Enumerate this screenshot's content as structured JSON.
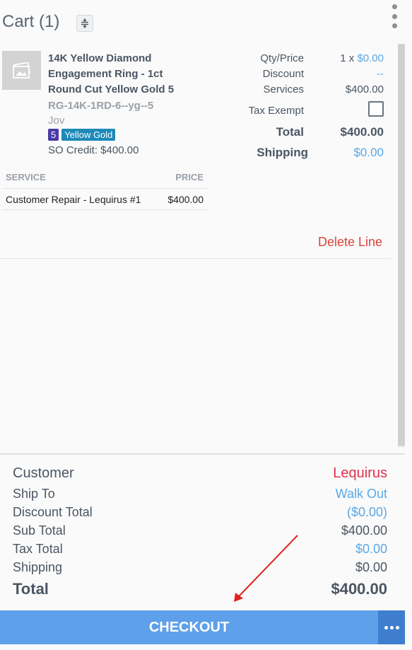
{
  "header": {
    "title": "Cart (1)"
  },
  "item": {
    "title": "14K Yellow Diamond Engagement Ring - 1ct Round Cut Yellow Gold 5",
    "sku": "RG-14K-1RD-6--yg--5",
    "vendor": "Jov",
    "badge_size": "5",
    "badge_metal": "Yellow Gold",
    "so_credit": "SO Credit: $400.00",
    "qty_price_label": "Qty/Price",
    "qty_prefix": "1 x ",
    "unit_price": "$0.00",
    "discount_label": "Discount",
    "discount_value": "--",
    "services_label": "Services",
    "services_value": "$400.00",
    "tax_exempt_label": "Tax Exempt",
    "total_label": "Total",
    "total_value": "$400.00",
    "shipping_label": "Shipping",
    "shipping_value": "$0.00",
    "delete_label": "Delete Line"
  },
  "services": {
    "headers": [
      "SERVICE",
      "PRICE"
    ],
    "rows": [
      {
        "service": "Customer Repair - Lequirus #1",
        "price": "$400.00"
      }
    ]
  },
  "summary": {
    "customer_label": "Customer",
    "customer_value": "Lequirus",
    "ship_to_label": "Ship To",
    "ship_to_value": "Walk Out",
    "discount_total_label": "Discount Total",
    "discount_total_value": "($0.00)",
    "sub_total_label": "Sub Total",
    "sub_total_value": "$400.00",
    "tax_total_label": "Tax Total",
    "tax_total_value": "$0.00",
    "shipping_label": "Shipping",
    "shipping_value": "$0.00",
    "total_label": "Total",
    "total_value": "$400.00"
  },
  "checkout_label": "CHECKOUT",
  "colors": {
    "accent": "#5ea0ea",
    "link": "#5aa8e6",
    "danger": "#d9433a",
    "customer": "#e0304e"
  },
  "icons": [
    "collapse-expand-icon",
    "kebab-menu-icon",
    "image-placeholder-icon",
    "more-dots-icon"
  ]
}
